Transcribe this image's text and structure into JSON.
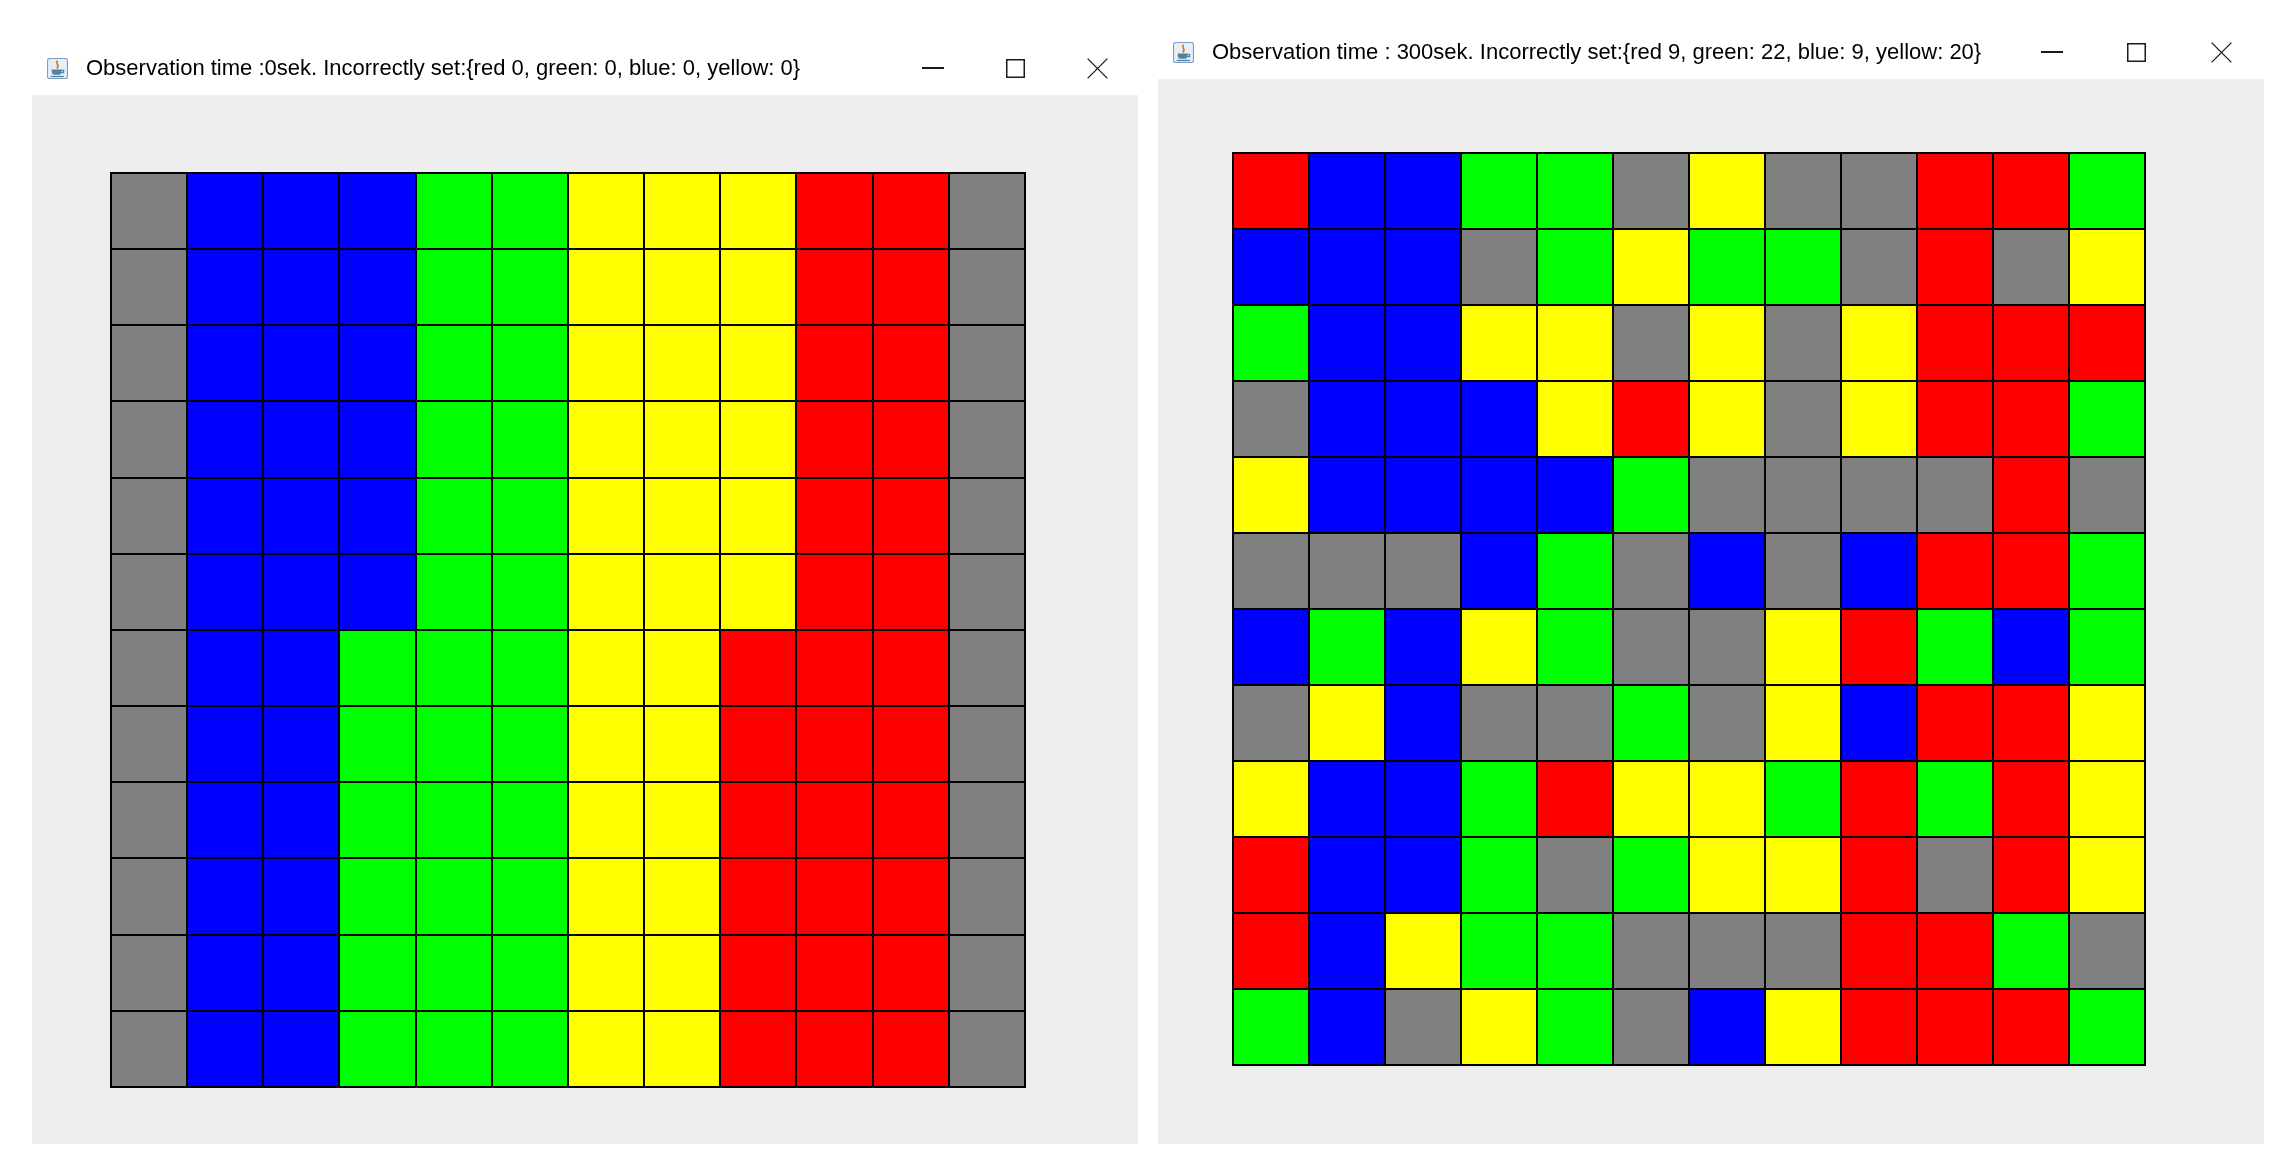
{
  "windows": [
    {
      "title": "Observation time :0sek. Incorrectly set:{red 0, green: 0, blue: 0, yellow: 0}",
      "board": {
        "rows": [
          {
            "cells": [
              {
                "color": "#808080"
              },
              {
                "color": "#0000ff"
              },
              {
                "color": "#0000ff"
              },
              {
                "color": "#0000ff"
              },
              {
                "color": "#00ff00"
              },
              {
                "color": "#00ff00"
              },
              {
                "color": "#ffff00"
              },
              {
                "color": "#ffff00"
              },
              {
                "color": "#ffff00"
              },
              {
                "color": "#ff0000"
              },
              {
                "color": "#ff0000"
              },
              {
                "color": "#808080"
              }
            ]
          },
          {
            "cells": [
              {
                "color": "#808080"
              },
              {
                "color": "#0000ff"
              },
              {
                "color": "#0000ff"
              },
              {
                "color": "#0000ff"
              },
              {
                "color": "#00ff00"
              },
              {
                "color": "#00ff00"
              },
              {
                "color": "#ffff00"
              },
              {
                "color": "#ffff00"
              },
              {
                "color": "#ffff00"
              },
              {
                "color": "#ff0000"
              },
              {
                "color": "#ff0000"
              },
              {
                "color": "#808080"
              }
            ]
          },
          {
            "cells": [
              {
                "color": "#808080"
              },
              {
                "color": "#0000ff"
              },
              {
                "color": "#0000ff"
              },
              {
                "color": "#0000ff"
              },
              {
                "color": "#00ff00"
              },
              {
                "color": "#00ff00"
              },
              {
                "color": "#ffff00"
              },
              {
                "color": "#ffff00"
              },
              {
                "color": "#ffff00"
              },
              {
                "color": "#ff0000"
              },
              {
                "color": "#ff0000"
              },
              {
                "color": "#808080"
              }
            ]
          },
          {
            "cells": [
              {
                "color": "#808080"
              },
              {
                "color": "#0000ff"
              },
              {
                "color": "#0000ff"
              },
              {
                "color": "#0000ff"
              },
              {
                "color": "#00ff00"
              },
              {
                "color": "#00ff00"
              },
              {
                "color": "#ffff00"
              },
              {
                "color": "#ffff00"
              },
              {
                "color": "#ffff00"
              },
              {
                "color": "#ff0000"
              },
              {
                "color": "#ff0000"
              },
              {
                "color": "#808080"
              }
            ]
          },
          {
            "cells": [
              {
                "color": "#808080"
              },
              {
                "color": "#0000ff"
              },
              {
                "color": "#0000ff"
              },
              {
                "color": "#0000ff"
              },
              {
                "color": "#00ff00"
              },
              {
                "color": "#00ff00"
              },
              {
                "color": "#ffff00"
              },
              {
                "color": "#ffff00"
              },
              {
                "color": "#ffff00"
              },
              {
                "color": "#ff0000"
              },
              {
                "color": "#ff0000"
              },
              {
                "color": "#808080"
              }
            ]
          },
          {
            "cells": [
              {
                "color": "#808080"
              },
              {
                "color": "#0000ff"
              },
              {
                "color": "#0000ff"
              },
              {
                "color": "#0000ff"
              },
              {
                "color": "#00ff00"
              },
              {
                "color": "#00ff00"
              },
              {
                "color": "#ffff00"
              },
              {
                "color": "#ffff00"
              },
              {
                "color": "#ffff00"
              },
              {
                "color": "#ff0000"
              },
              {
                "color": "#ff0000"
              },
              {
                "color": "#808080"
              }
            ]
          },
          {
            "cells": [
              {
                "color": "#808080"
              },
              {
                "color": "#0000ff"
              },
              {
                "color": "#0000ff"
              },
              {
                "color": "#00ff00"
              },
              {
                "color": "#00ff00"
              },
              {
                "color": "#00ff00"
              },
              {
                "color": "#ffff00"
              },
              {
                "color": "#ffff00"
              },
              {
                "color": "#ff0000"
              },
              {
                "color": "#ff0000"
              },
              {
                "color": "#ff0000"
              },
              {
                "color": "#808080"
              }
            ]
          },
          {
            "cells": [
              {
                "color": "#808080"
              },
              {
                "color": "#0000ff"
              },
              {
                "color": "#0000ff"
              },
              {
                "color": "#00ff00"
              },
              {
                "color": "#00ff00"
              },
              {
                "color": "#00ff00"
              },
              {
                "color": "#ffff00"
              },
              {
                "color": "#ffff00"
              },
              {
                "color": "#ff0000"
              },
              {
                "color": "#ff0000"
              },
              {
                "color": "#ff0000"
              },
              {
                "color": "#808080"
              }
            ]
          },
          {
            "cells": [
              {
                "color": "#808080"
              },
              {
                "color": "#0000ff"
              },
              {
                "color": "#0000ff"
              },
              {
                "color": "#00ff00"
              },
              {
                "color": "#00ff00"
              },
              {
                "color": "#00ff00"
              },
              {
                "color": "#ffff00"
              },
              {
                "color": "#ffff00"
              },
              {
                "color": "#ff0000"
              },
              {
                "color": "#ff0000"
              },
              {
                "color": "#ff0000"
              },
              {
                "color": "#808080"
              }
            ]
          },
          {
            "cells": [
              {
                "color": "#808080"
              },
              {
                "color": "#0000ff"
              },
              {
                "color": "#0000ff"
              },
              {
                "color": "#00ff00"
              },
              {
                "color": "#00ff00"
              },
              {
                "color": "#00ff00"
              },
              {
                "color": "#ffff00"
              },
              {
                "color": "#ffff00"
              },
              {
                "color": "#ff0000"
              },
              {
                "color": "#ff0000"
              },
              {
                "color": "#ff0000"
              },
              {
                "color": "#808080"
              }
            ]
          },
          {
            "cells": [
              {
                "color": "#808080"
              },
              {
                "color": "#0000ff"
              },
              {
                "color": "#0000ff"
              },
              {
                "color": "#00ff00"
              },
              {
                "color": "#00ff00"
              },
              {
                "color": "#00ff00"
              },
              {
                "color": "#ffff00"
              },
              {
                "color": "#ffff00"
              },
              {
                "color": "#ff0000"
              },
              {
                "color": "#ff0000"
              },
              {
                "color": "#ff0000"
              },
              {
                "color": "#808080"
              }
            ]
          },
          {
            "cells": [
              {
                "color": "#808080"
              },
              {
                "color": "#0000ff"
              },
              {
                "color": "#0000ff"
              },
              {
                "color": "#00ff00"
              },
              {
                "color": "#00ff00"
              },
              {
                "color": "#00ff00"
              },
              {
                "color": "#ffff00"
              },
              {
                "color": "#ffff00"
              },
              {
                "color": "#ff0000"
              },
              {
                "color": "#ff0000"
              },
              {
                "color": "#ff0000"
              },
              {
                "color": "#808080"
              }
            ]
          }
        ]
      }
    },
    {
      "title": "Observation time : 300sek. Incorrectly set:{red 9, green: 22, blue: 9, yellow: 20}",
      "board": {
        "rows": [
          {
            "cells": [
              {
                "color": "#ff0000"
              },
              {
                "color": "#0000ff"
              },
              {
                "color": "#0000ff"
              },
              {
                "color": "#00ff00"
              },
              {
                "color": "#00ff00"
              },
              {
                "color": "#808080"
              },
              {
                "color": "#ffff00"
              },
              {
                "color": "#808080"
              },
              {
                "color": "#808080"
              },
              {
                "color": "#ff0000"
              },
              {
                "color": "#ff0000"
              },
              {
                "color": "#00ff00"
              }
            ]
          },
          {
            "cells": [
              {
                "color": "#0000ff"
              },
              {
                "color": "#0000ff"
              },
              {
                "color": "#0000ff"
              },
              {
                "color": "#808080"
              },
              {
                "color": "#00ff00"
              },
              {
                "color": "#ffff00"
              },
              {
                "color": "#00ff00"
              },
              {
                "color": "#00ff00"
              },
              {
                "color": "#808080"
              },
              {
                "color": "#ff0000"
              },
              {
                "color": "#808080"
              },
              {
                "color": "#ffff00"
              }
            ]
          },
          {
            "cells": [
              {
                "color": "#00ff00"
              },
              {
                "color": "#0000ff"
              },
              {
                "color": "#0000ff"
              },
              {
                "color": "#ffff00"
              },
              {
                "color": "#ffff00"
              },
              {
                "color": "#808080"
              },
              {
                "color": "#ffff00"
              },
              {
                "color": "#808080"
              },
              {
                "color": "#ffff00"
              },
              {
                "color": "#ff0000"
              },
              {
                "color": "#ff0000"
              },
              {
                "color": "#ff0000"
              }
            ]
          },
          {
            "cells": [
              {
                "color": "#808080"
              },
              {
                "color": "#0000ff"
              },
              {
                "color": "#0000ff"
              },
              {
                "color": "#0000ff"
              },
              {
                "color": "#ffff00"
              },
              {
                "color": "#ff0000"
              },
              {
                "color": "#ffff00"
              },
              {
                "color": "#808080"
              },
              {
                "color": "#ffff00"
              },
              {
                "color": "#ff0000"
              },
              {
                "color": "#ff0000"
              },
              {
                "color": "#00ff00"
              }
            ]
          },
          {
            "cells": [
              {
                "color": "#ffff00"
              },
              {
                "color": "#0000ff"
              },
              {
                "color": "#0000ff"
              },
              {
                "color": "#0000ff"
              },
              {
                "color": "#0000ff"
              },
              {
                "color": "#00ff00"
              },
              {
                "color": "#808080"
              },
              {
                "color": "#808080"
              },
              {
                "color": "#808080"
              },
              {
                "color": "#808080"
              },
              {
                "color": "#ff0000"
              },
              {
                "color": "#808080"
              }
            ]
          },
          {
            "cells": [
              {
                "color": "#808080"
              },
              {
                "color": "#808080"
              },
              {
                "color": "#808080"
              },
              {
                "color": "#0000ff"
              },
              {
                "color": "#00ff00"
              },
              {
                "color": "#808080"
              },
              {
                "color": "#0000ff"
              },
              {
                "color": "#808080"
              },
              {
                "color": "#0000ff"
              },
              {
                "color": "#ff0000"
              },
              {
                "color": "#ff0000"
              },
              {
                "color": "#00ff00"
              }
            ]
          },
          {
            "cells": [
              {
                "color": "#0000ff"
              },
              {
                "color": "#00ff00"
              },
              {
                "color": "#0000ff"
              },
              {
                "color": "#ffff00"
              },
              {
                "color": "#00ff00"
              },
              {
                "color": "#808080"
              },
              {
                "color": "#808080"
              },
              {
                "color": "#ffff00"
              },
              {
                "color": "#ff0000"
              },
              {
                "color": "#00ff00"
              },
              {
                "color": "#0000ff"
              },
              {
                "color": "#00ff00"
              }
            ]
          },
          {
            "cells": [
              {
                "color": "#808080"
              },
              {
                "color": "#ffff00"
              },
              {
                "color": "#0000ff"
              },
              {
                "color": "#808080"
              },
              {
                "color": "#808080"
              },
              {
                "color": "#00ff00"
              },
              {
                "color": "#808080"
              },
              {
                "color": "#ffff00"
              },
              {
                "color": "#0000ff"
              },
              {
                "color": "#ff0000"
              },
              {
                "color": "#ff0000"
              },
              {
                "color": "#ffff00"
              }
            ]
          },
          {
            "cells": [
              {
                "color": "#ffff00"
              },
              {
                "color": "#0000ff"
              },
              {
                "color": "#0000ff"
              },
              {
                "color": "#00ff00"
              },
              {
                "color": "#ff0000"
              },
              {
                "color": "#ffff00"
              },
              {
                "color": "#ffff00"
              },
              {
                "color": "#00ff00"
              },
              {
                "color": "#ff0000"
              },
              {
                "color": "#00ff00"
              },
              {
                "color": "#ff0000"
              },
              {
                "color": "#ffff00"
              }
            ]
          },
          {
            "cells": [
              {
                "color": "#ff0000"
              },
              {
                "color": "#0000ff"
              },
              {
                "color": "#0000ff"
              },
              {
                "color": "#00ff00"
              },
              {
                "color": "#808080"
              },
              {
                "color": "#00ff00"
              },
              {
                "color": "#ffff00"
              },
              {
                "color": "#ffff00"
              },
              {
                "color": "#ff0000"
              },
              {
                "color": "#808080"
              },
              {
                "color": "#ff0000"
              },
              {
                "color": "#ffff00"
              }
            ]
          },
          {
            "cells": [
              {
                "color": "#ff0000"
              },
              {
                "color": "#0000ff"
              },
              {
                "color": "#ffff00"
              },
              {
                "color": "#00ff00"
              },
              {
                "color": "#00ff00"
              },
              {
                "color": "#808080"
              },
              {
                "color": "#808080"
              },
              {
                "color": "#808080"
              },
              {
                "color": "#ff0000"
              },
              {
                "color": "#ff0000"
              },
              {
                "color": "#00ff00"
              },
              {
                "color": "#808080"
              }
            ]
          },
          {
            "cells": [
              {
                "color": "#00ff00"
              },
              {
                "color": "#0000ff"
              },
              {
                "color": "#808080"
              },
              {
                "color": "#ffff00"
              },
              {
                "color": "#00ff00"
              },
              {
                "color": "#808080"
              },
              {
                "color": "#0000ff"
              },
              {
                "color": "#ffff00"
              },
              {
                "color": "#ff0000"
              },
              {
                "color": "#ff0000"
              },
              {
                "color": "#ff0000"
              },
              {
                "color": "#00ff00"
              }
            ]
          }
        ]
      }
    }
  ]
}
